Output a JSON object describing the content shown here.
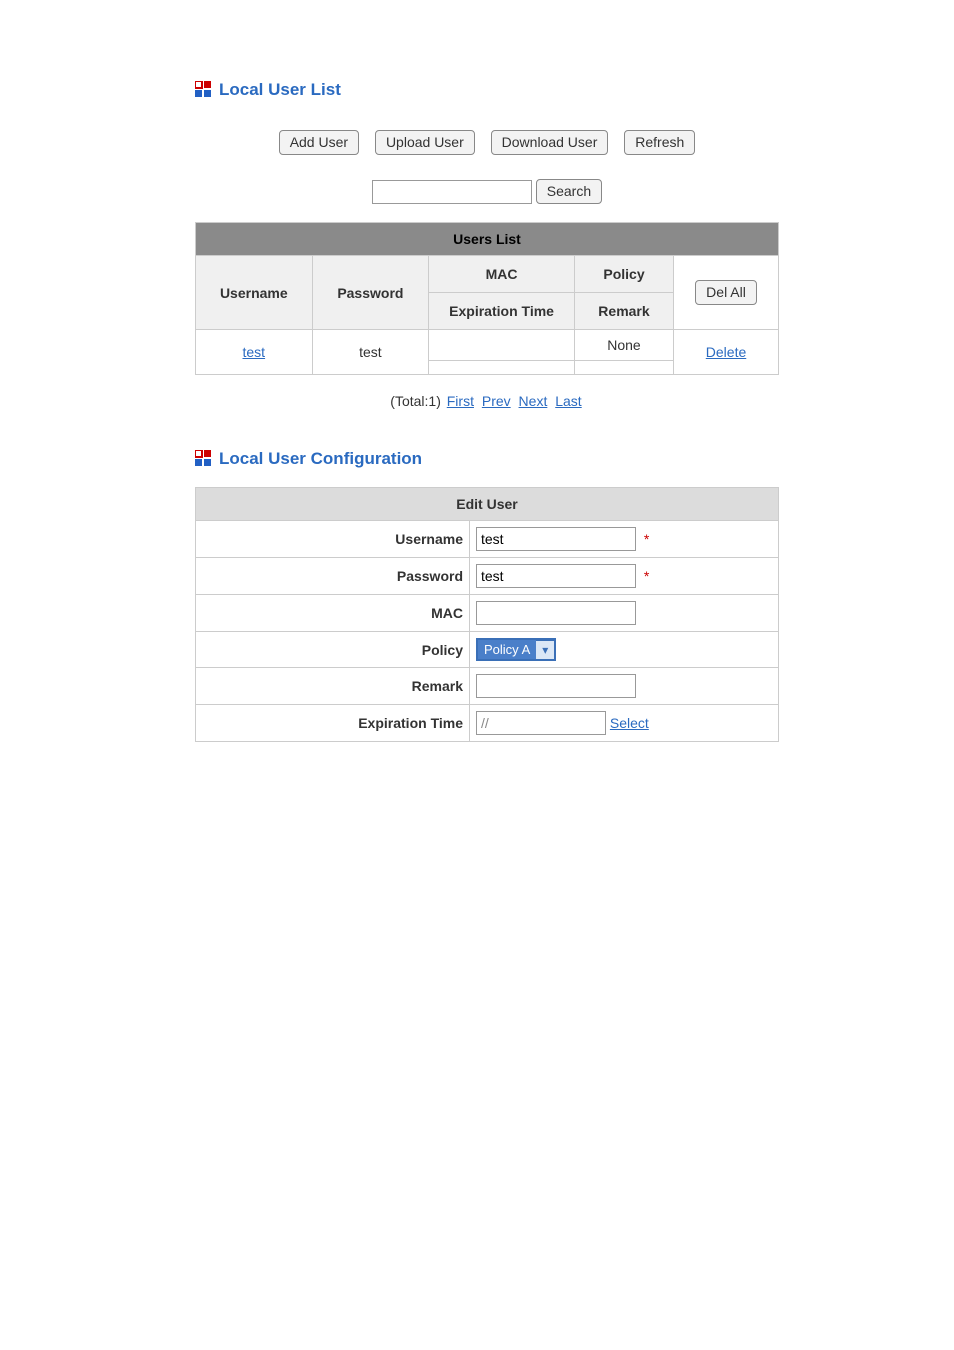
{
  "list_section": {
    "title": "Local User List",
    "buttons": {
      "add": "Add User",
      "upload": "Upload User",
      "download": "Download User",
      "refresh": "Refresh"
    },
    "search": {
      "value": "",
      "button": "Search"
    },
    "table": {
      "caption": "Users List",
      "cols": {
        "username": "Username",
        "password": "Password",
        "mac": "MAC",
        "policy": "Policy",
        "expiration": "Expiration Time",
        "remark": "Remark",
        "del_all": "Del All"
      },
      "rows": [
        {
          "username": "test",
          "password": "test",
          "mac": "",
          "policy": "None",
          "expiration": "",
          "remark": "",
          "action": "Delete"
        }
      ]
    },
    "pager": {
      "total_label": "(Total:1)",
      "first": "First",
      "prev": "Prev",
      "next": "Next",
      "last": "Last"
    }
  },
  "config_section": {
    "title": "Local User Configuration",
    "caption": "Edit User",
    "labels": {
      "username": "Username",
      "password": "Password",
      "mac": "MAC",
      "policy": "Policy",
      "remark": "Remark",
      "expiration": "Expiration Time"
    },
    "values": {
      "username": "test",
      "password": "test",
      "mac": "",
      "policy": "Policy A",
      "remark": "",
      "expiration": "//"
    },
    "select_link": "Select"
  }
}
